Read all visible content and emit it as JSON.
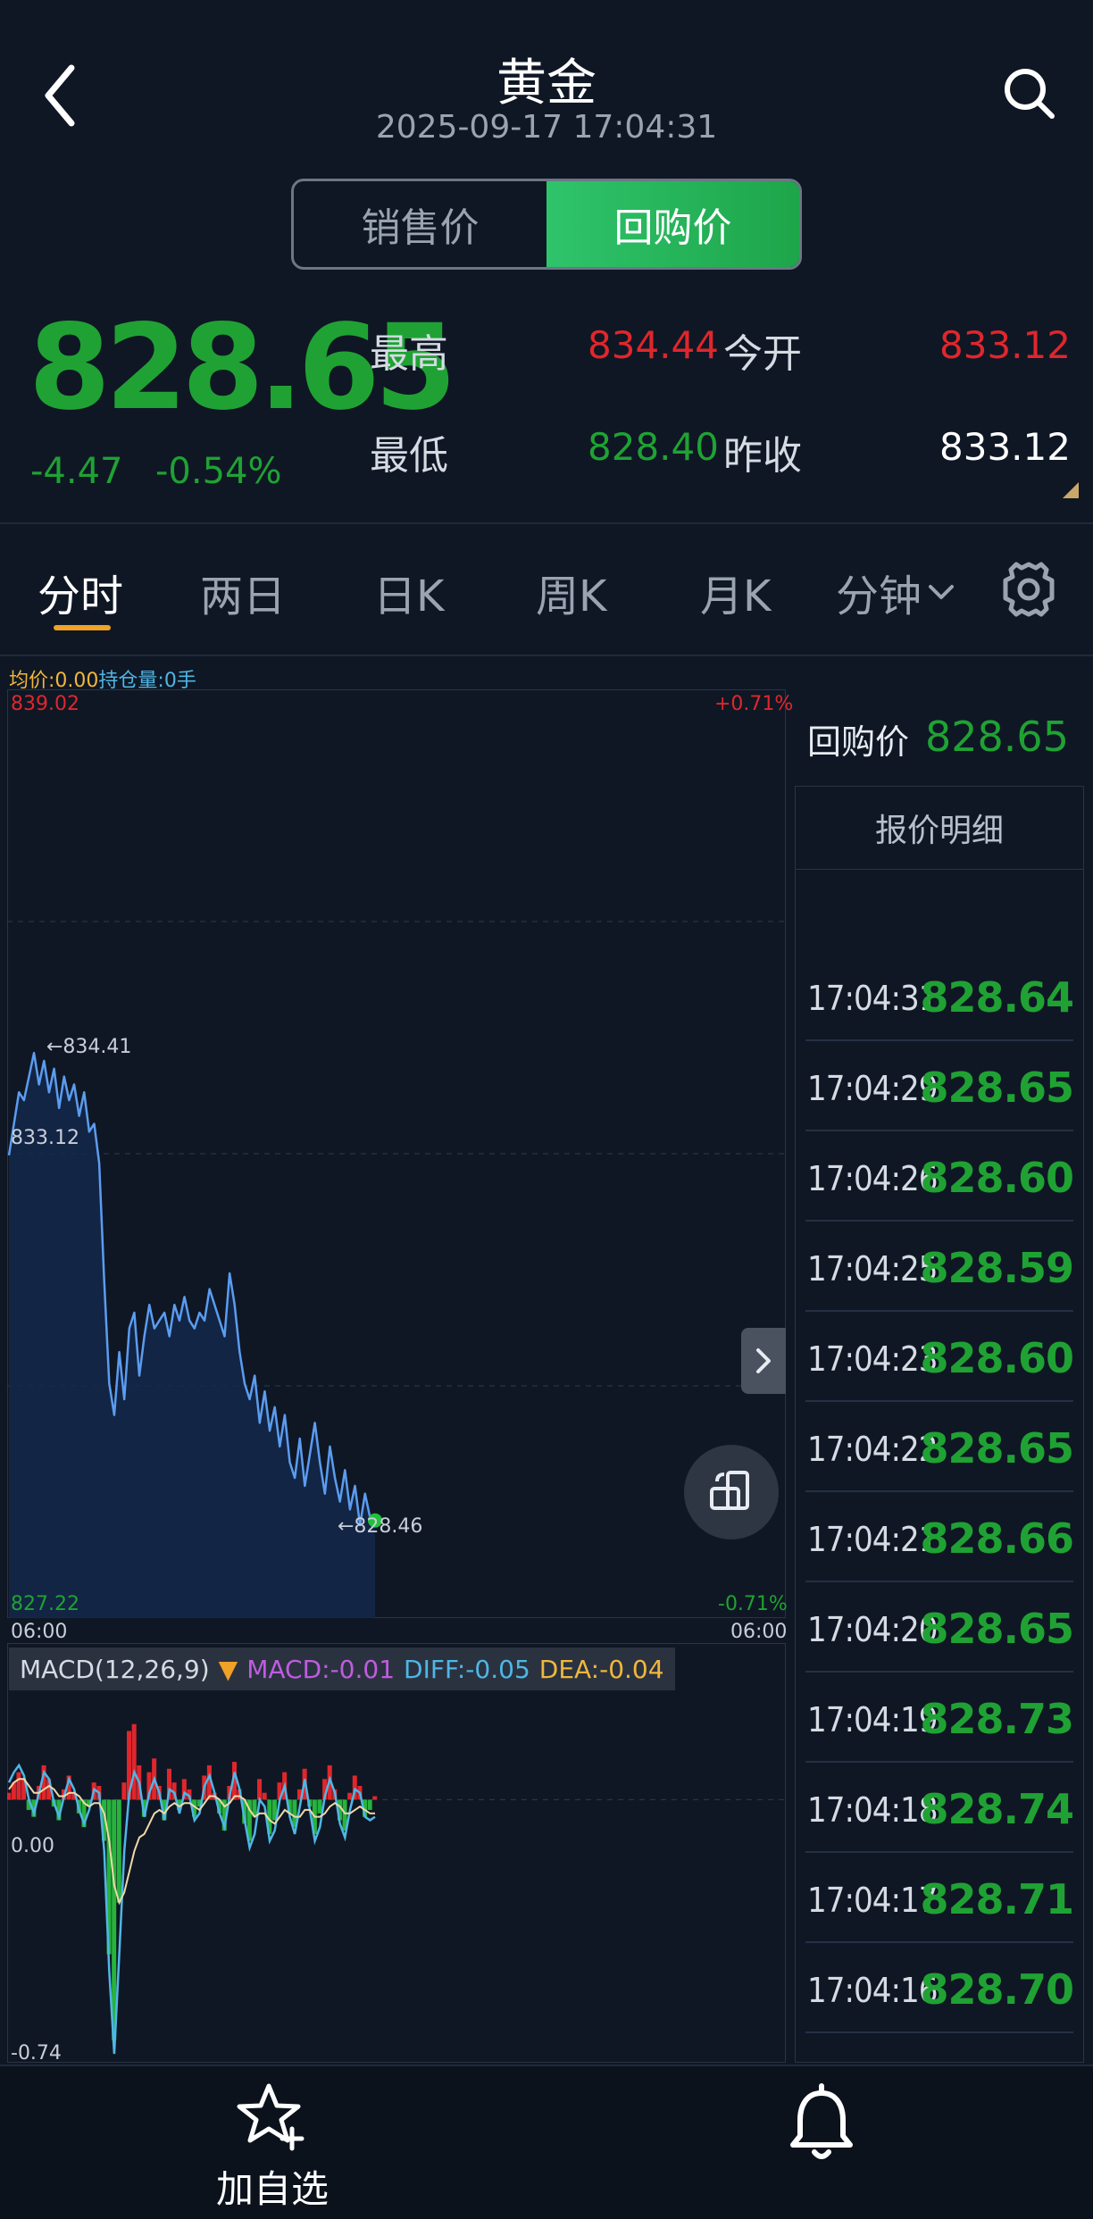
{
  "header": {
    "title": "黄金",
    "datetime": "2025-09-17 17:04:31"
  },
  "segment": {
    "sell_label": "销售价",
    "buy_label": "回购价",
    "active": "回购价"
  },
  "quote": {
    "price": "828.65",
    "change": "-4.47",
    "change_pct": "-0.54%",
    "high_label": "最高",
    "high": "834.44",
    "low_label": "最低",
    "low": "828.40",
    "open_label": "今开",
    "open": "833.12",
    "prev_close_label": "昨收",
    "prev_close": "833.12"
  },
  "tabs": {
    "items": [
      "分时",
      "两日",
      "日K",
      "周K",
      "月K",
      "分钟"
    ],
    "active": "分时"
  },
  "chart_info": {
    "avg": "均价:0.00",
    "position": "持仓量:0手"
  },
  "chart_axis": {
    "y_top": "839.02",
    "y_bottom": "827.22",
    "pct_top": "+0.71%",
    "pct_bottom": "-0.71%",
    "y_mid": "833.12",
    "x_left": "06:00",
    "x_right": "06:00",
    "high_marker": "←834.41",
    "last_marker": "←828.46"
  },
  "macd": {
    "params": "MACD(12,26,9)",
    "macd": "MACD:-0.01",
    "diff": "DIFF:-0.05",
    "dea": "DEA:-0.04",
    "zero_label": "0.00",
    "min_label": "-0.74"
  },
  "right_panel": {
    "label": "回购价",
    "value": "828.65",
    "header": "报价明细",
    "ticks": [
      {
        "time": "17:04:31",
        "price": "828.64"
      },
      {
        "time": "17:04:29",
        "price": "828.65"
      },
      {
        "time": "17:04:26",
        "price": "828.60"
      },
      {
        "time": "17:04:25",
        "price": "828.59"
      },
      {
        "time": "17:04:23",
        "price": "828.60"
      },
      {
        "time": "17:04:22",
        "price": "828.65"
      },
      {
        "time": "17:04:21",
        "price": "828.66"
      },
      {
        "time": "17:04:20",
        "price": "828.65"
      },
      {
        "time": "17:04:19",
        "price": "828.73"
      },
      {
        "time": "17:04:18",
        "price": "828.74"
      },
      {
        "time": "17:04:17",
        "price": "828.71"
      },
      {
        "time": "17:04:16",
        "price": "828.70"
      }
    ]
  },
  "bottom": {
    "add_watch_label": "加自选"
  },
  "chart_data": {
    "type": "line",
    "title": "",
    "ylim": [
      827.22,
      839.02
    ],
    "series": [
      {
        "values": [
          833.1,
          833.5,
          833.9,
          833.8,
          834.1,
          834.4,
          834.0,
          834.3,
          833.9,
          834.2,
          833.7,
          834.1,
          833.8,
          834.0,
          833.6,
          833.9,
          833.4,
          833.5,
          833.0,
          831.5,
          830.2,
          829.8,
          830.6,
          830.0,
          830.9,
          831.1,
          830.3,
          830.8,
          831.2,
          830.9,
          831.0,
          831.1,
          830.8,
          831.2,
          831.0,
          831.3,
          831.0,
          830.9,
          831.1,
          831.0,
          831.4,
          831.2,
          831.0,
          830.8,
          831.6,
          831.2,
          830.6,
          830.2,
          830.0,
          830.3,
          829.7,
          830.1,
          829.6,
          829.9,
          829.4,
          829.8,
          829.2,
          829.0,
          829.5,
          828.9,
          829.3,
          829.7,
          829.2,
          828.8,
          829.4,
          829.0,
          828.7,
          829.1,
          828.6,
          828.9,
          828.4,
          828.8,
          828.5,
          828.46
        ]
      }
    ]
  },
  "macd_data": {
    "type": "bar",
    "ylim": [
      -0.74,
      0.3
    ],
    "histogram": [
      0.02,
      0.05,
      0.08,
      0.06,
      -0.03,
      -0.05,
      0.04,
      0.1,
      0.06,
      -0.02,
      -0.06,
      0.03,
      0.07,
      0.02,
      -0.04,
      -0.08,
      -0.02,
      0.05,
      0.04,
      -0.12,
      -0.45,
      -0.7,
      -0.3,
      0.05,
      0.2,
      0.22,
      0.1,
      -0.05,
      0.08,
      0.12,
      0.04,
      -0.06,
      0.09,
      0.05,
      -0.03,
      0.06,
      0.03,
      -0.05,
      -0.02,
      0.07,
      0.1,
      0.02,
      -0.04,
      -0.09,
      0.04,
      0.11,
      0.03,
      -0.07,
      -0.12,
      -0.05,
      0.06,
      0.02,
      -0.1,
      -0.06,
      0.05,
      0.08,
      -0.04,
      -0.08,
      0.03,
      0.09,
      -0.02,
      -0.1,
      -0.04,
      0.06,
      0.1,
      0.03,
      -0.06,
      -0.09,
      0.02,
      0.07,
      0.04,
      -0.05,
      -0.03,
      0.01
    ],
    "diff": [
      0.05,
      0.08,
      0.1,
      0.07,
      0.0,
      -0.04,
      0.02,
      0.08,
      0.06,
      -0.01,
      -0.05,
      0.01,
      0.06,
      0.03,
      -0.03,
      -0.07,
      -0.03,
      0.03,
      0.02,
      -0.15,
      -0.5,
      -0.74,
      -0.45,
      -0.15,
      0.02,
      0.08,
      0.05,
      -0.05,
      0.02,
      0.06,
      0.02,
      -0.06,
      0.03,
      0.02,
      -0.04,
      0.02,
      0.01,
      -0.06,
      -0.04,
      0.04,
      0.07,
      0.02,
      -0.04,
      -0.08,
      0.01,
      0.08,
      0.03,
      -0.06,
      -0.14,
      -0.1,
      0.0,
      -0.02,
      -0.12,
      -0.09,
      0.0,
      0.04,
      -0.05,
      -0.1,
      -0.02,
      0.06,
      -0.03,
      -0.12,
      -0.08,
      0.01,
      0.06,
      0.02,
      -0.07,
      -0.11,
      -0.03,
      0.03,
      0.02,
      -0.05,
      -0.06,
      -0.05
    ],
    "dea": [
      0.03,
      0.05,
      0.06,
      0.06,
      0.04,
      0.02,
      0.02,
      0.03,
      0.04,
      0.03,
      0.01,
      0.01,
      0.02,
      0.02,
      0.01,
      -0.01,
      -0.02,
      -0.01,
      -0.01,
      -0.04,
      -0.12,
      -0.25,
      -0.3,
      -0.27,
      -0.21,
      -0.15,
      -0.11,
      -0.1,
      -0.07,
      -0.04,
      -0.03,
      -0.04,
      -0.02,
      -0.01,
      -0.02,
      -0.01,
      -0.01,
      -0.02,
      -0.03,
      -0.01,
      0.01,
      0.01,
      0.0,
      -0.02,
      -0.01,
      0.01,
      0.01,
      0.0,
      -0.03,
      -0.05,
      -0.04,
      -0.04,
      -0.06,
      -0.07,
      -0.05,
      -0.03,
      -0.04,
      -0.05,
      -0.05,
      -0.03,
      -0.03,
      -0.05,
      -0.05,
      -0.04,
      -0.02,
      -0.01,
      -0.02,
      -0.04,
      -0.04,
      -0.03,
      -0.02,
      -0.03,
      -0.04,
      -0.04
    ]
  }
}
